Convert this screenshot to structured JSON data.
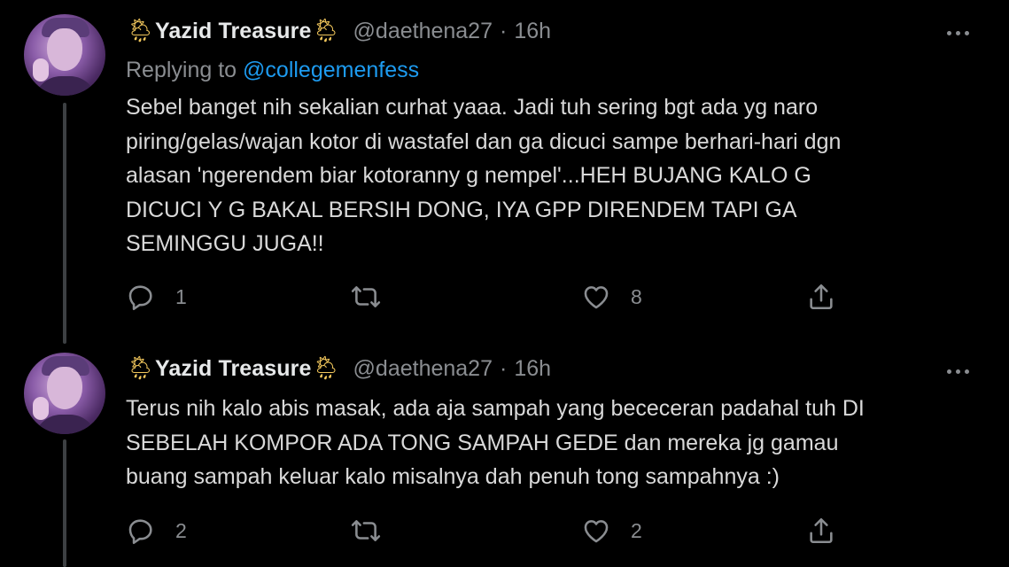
{
  "tweets": [
    {
      "display_name": "Yazid Treasure",
      "name_emoji_left": "🌦",
      "name_emoji_right": "🌦",
      "handle": "@daethena27",
      "separator": "·",
      "time": "16h",
      "reply_prefix": "Replying to",
      "reply_to": "@collegemenfess",
      "body_lines": [
        "Sebel banget nih sekalian curhat yaaa. Jadi tuh sering bgt ada yg naro",
        "piring/gelas/wajan kotor di wastafel dan ga dicuci sampe berhari-hari dgn",
        "alasan 'ngerendem biar kotoranny g nempel'...HEH BUJANG KALO G",
        "DICUCI Y G BAKAL BERSIH DONG, IYA GPP DIRENDEM TAPI GA",
        "SEMINGGU JUGA!!"
      ],
      "reply_count": "1",
      "retweet_count": "",
      "like_count": "8"
    },
    {
      "display_name": "Yazid Treasure",
      "name_emoji_left": "🌦",
      "name_emoji_right": "🌦",
      "handle": "@daethena27",
      "separator": "·",
      "time": "16h",
      "body_lines": [
        "Terus nih kalo abis masak, ada aja sampah yang bececeran padahal tuh DI",
        "SEBELAH KOMPOR ADA TONG SAMPAH GEDE dan mereka jg gamau",
        "buang sampah keluar kalo misalnya dah penuh tong sampahnya :)"
      ],
      "reply_count": "2",
      "retweet_count": "",
      "like_count": "2"
    }
  ],
  "icons": {
    "reply": "speech-bubble-icon",
    "retweet": "retweet-arrows-icon",
    "like": "heart-icon",
    "share": "share-upload-icon",
    "more": "ellipsis-icon"
  },
  "colors": {
    "background": "#000000",
    "text": "#d9d9d9",
    "secondary": "#8a8d91",
    "mention": "#1d9bf0",
    "thread_line": "#3d4043"
  }
}
